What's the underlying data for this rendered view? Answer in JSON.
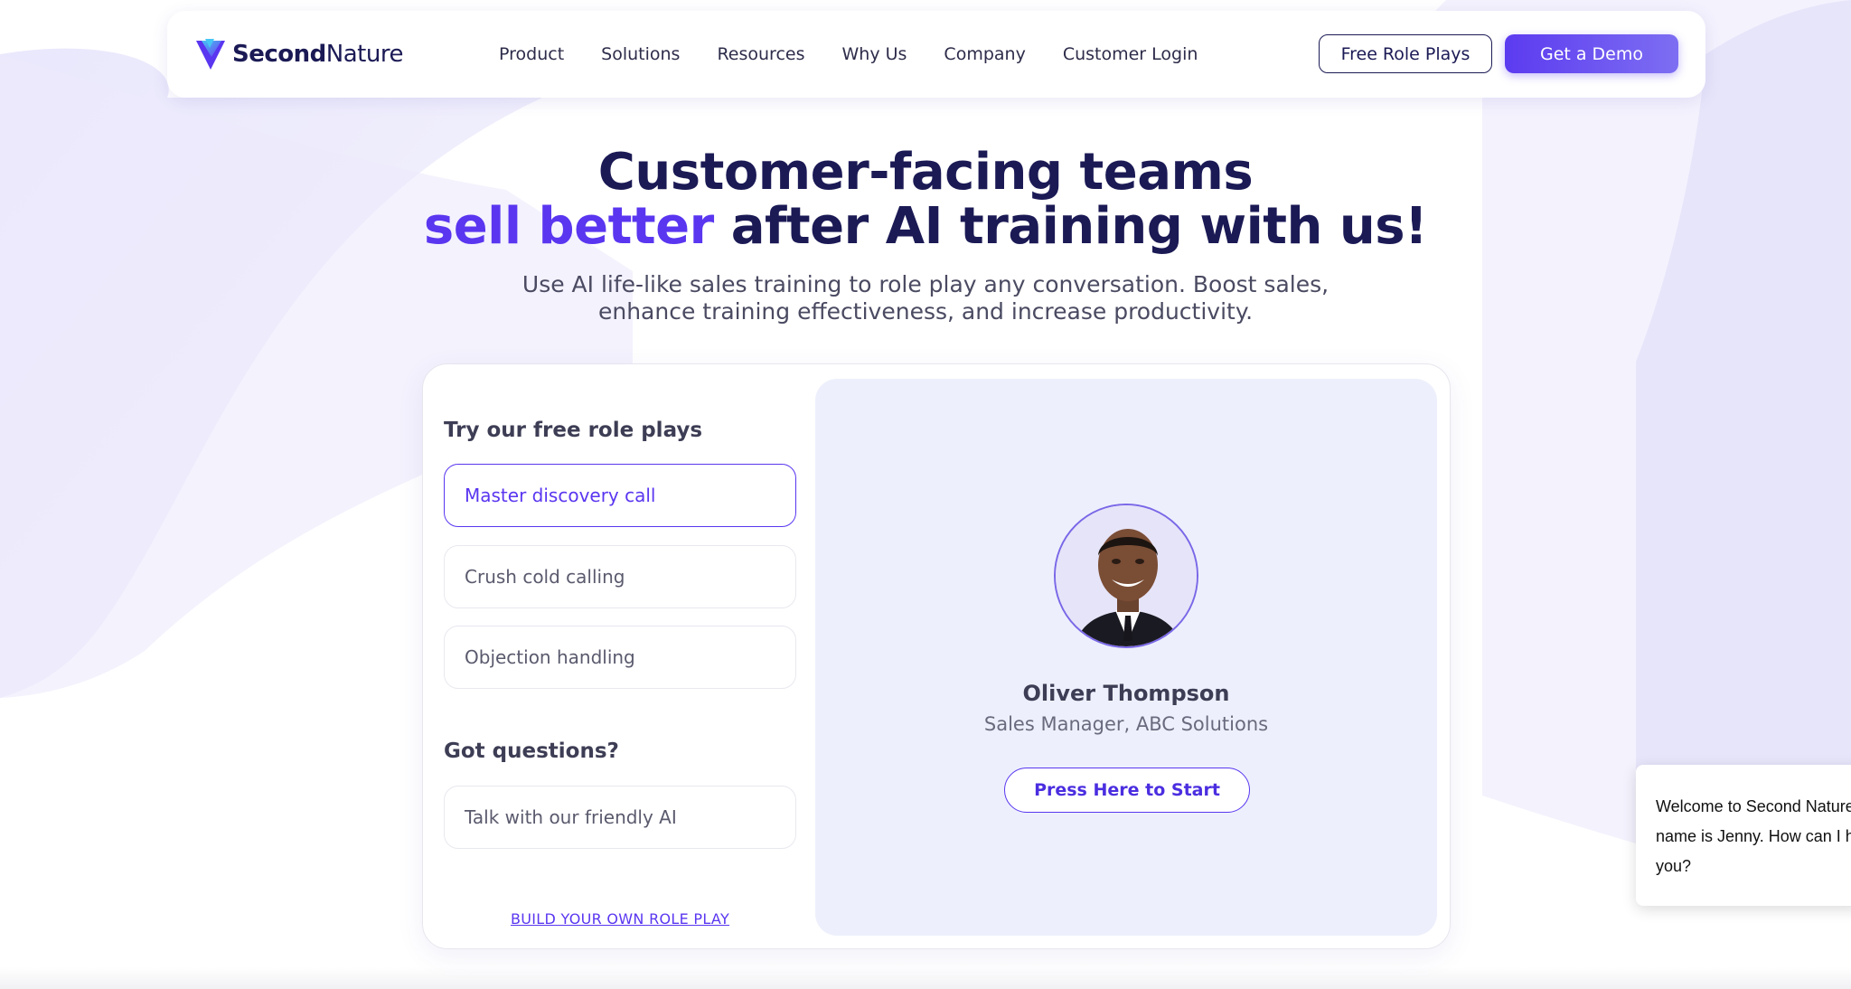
{
  "brand": {
    "name_bold": "Second",
    "name_rest": "Nature",
    "accent": "#5a36f0",
    "dark": "#1b1a55"
  },
  "nav": {
    "links": [
      "Product",
      "Solutions",
      "Resources",
      "Why Us",
      "Company",
      "Customer Login"
    ],
    "free_role_plays": "Free Role Plays",
    "get_demo": "Get a Demo"
  },
  "hero": {
    "line1": "Customer-facing teams",
    "accent": "sell better",
    "line2_rest": " after AI training with us!",
    "sub_line1": "Use AI life-like sales training to role play any conversation. Boost sales,",
    "sub_line2": "enhance training effectiveness, and increase productivity."
  },
  "roleplays": {
    "title": "Try our free role plays",
    "options": [
      "Master discovery call",
      "Crush cold calling",
      "Objection handling"
    ],
    "active_index": 0,
    "questions_title": "Got questions?",
    "ai_option": "Talk with our friendly AI",
    "build_link": "BUILD YOUR OWN ROLE PLAY"
  },
  "persona": {
    "name": "Oliver Thompson",
    "title": "Sales Manager, ABC Solutions",
    "start": "Press Here to Start"
  },
  "chat": {
    "line1": "Welcome to Second Nature! My",
    "line2": "name is Jenny. How can I help",
    "line3": "you?"
  }
}
